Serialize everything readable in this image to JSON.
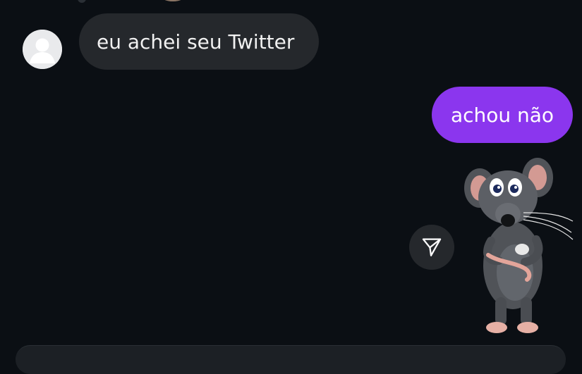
{
  "conversation": {
    "messages": [
      {
        "direction": "incoming",
        "text": "eu achei seu Twitter"
      },
      {
        "direction": "outgoing",
        "text": "achou não"
      }
    ],
    "sticker": {
      "icon": "rat-sticker-icon"
    },
    "share_button": {
      "icon": "send-icon"
    }
  },
  "colors": {
    "background": "#0b0f14",
    "incoming_bubble": "#25282c",
    "outgoing_bubble": "#8b36ee"
  }
}
